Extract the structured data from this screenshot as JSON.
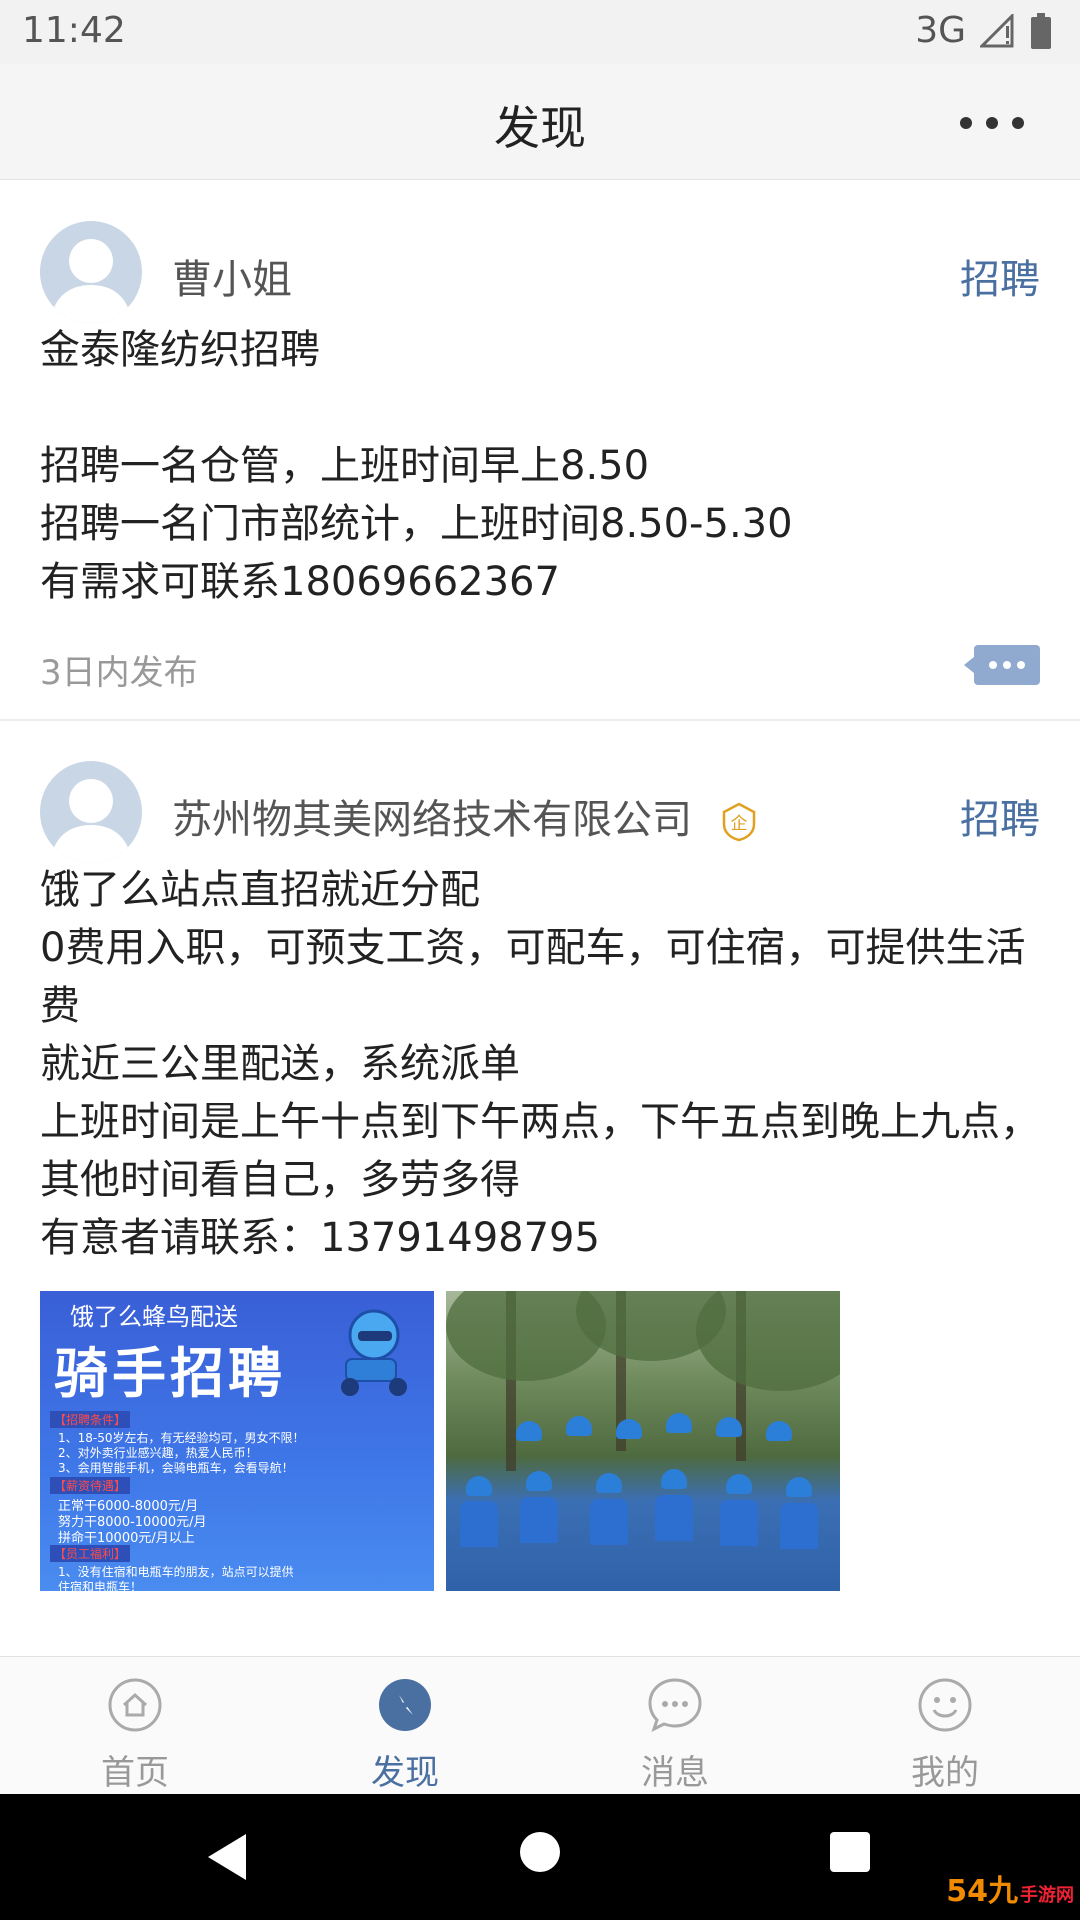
{
  "status_bar": {
    "time": "11:42",
    "network": "3G"
  },
  "header": {
    "title": "发现",
    "more_icon": "more-dots-icon"
  },
  "posts": [
    {
      "author": "曹小姐",
      "category": "招聘",
      "lines": [
        "金泰隆纺织招聘",
        "",
        "招聘一名仓管，上班时间早上8.50",
        "招聘一名门市部统计，上班时间8.50-5.30",
        "有需求可联系18069662367"
      ],
      "time": "3日内发布"
    },
    {
      "author": "苏州物其美网络技术有限公司",
      "verified_badge": "企",
      "category": "招聘",
      "lines": [
        "饿了么站点直招就近分配",
        "0费用入职，可预支工资，可配车，可住宿，可提供生活",
        "费",
        "就近三公里配送，系统派单",
        "上班时间是上午十点到下午两点，下午五点到晚上九点，",
        "其他时间看自己，多劳多得",
        "有意者请联系：13791498795"
      ],
      "poster": {
        "top": "饿了么蜂鸟配送",
        "title": "骑手招聘",
        "section1": "【招聘条件】",
        "req1": "1、18-50岁左右，有无经验均可，男女不限！",
        "req2": "2、对外卖行业感兴趣，热爱人民币！",
        "req3": "3、会用智能手机，会骑电瓶车，会看导航！",
        "section2": "【薪资待遇】",
        "pay1": "正常干6000-8000元/月",
        "pay2": "努力干8000-10000元/月",
        "pay3": "拼命干10000元/月以上",
        "section3": "【员工福利】",
        "ben1": "1、没有住宿和电瓶车的朋友，站点可以提供",
        "ben2": "住宿和电瓶车！"
      }
    }
  ],
  "bottom_nav": [
    {
      "label": "首页",
      "icon": "home-icon"
    },
    {
      "label": "发现",
      "icon": "compass-icon"
    },
    {
      "label": "消息",
      "icon": "message-icon"
    },
    {
      "label": "我的",
      "icon": "smiley-icon"
    }
  ],
  "active_tab": "发现",
  "colors": {
    "accent": "#4a6fa1",
    "verified_badge": "#e0a020"
  },
  "watermark": {
    "text": "54九",
    "sub": "手游网"
  }
}
